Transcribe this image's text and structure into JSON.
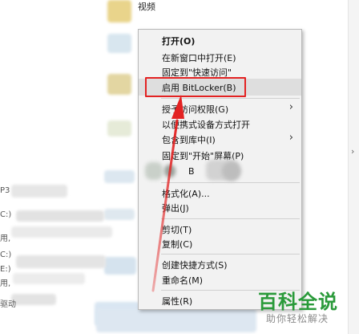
{
  "background": {
    "top_label": "视频",
    "left_partial": [
      "P3",
      "C:)",
      "用,",
      "C:)",
      "E:)",
      "用,",
      "驱动"
    ]
  },
  "context_menu": {
    "items": [
      {
        "label": "打开(O)",
        "bold": true
      },
      {
        "label": "在新窗口中打开(E)"
      },
      {
        "label": "固定到\"快速访问\""
      },
      {
        "label": "启用 BitLocker(B)",
        "highlighted": true
      },
      {
        "label": "授予访问权限(G)",
        "submenu": true
      },
      {
        "label": "以便携式设备方式打开"
      },
      {
        "label": "包含到库中(I)",
        "submenu": true
      },
      {
        "label": "固定到\"开始\"屏幕(P)"
      },
      {
        "label": "B"
      },
      {
        "label": "格式化(A)..."
      },
      {
        "label": "弹出(J)"
      },
      {
        "label": "剪切(T)"
      },
      {
        "label": "复制(C)"
      },
      {
        "label": "创建快捷方式(S)"
      },
      {
        "label": "重命名(M)"
      },
      {
        "label": "属性(R)"
      }
    ]
  },
  "watermark": {
    "logo": "百科全说",
    "subtitle": "助你轻松解决"
  },
  "colors": {
    "annotation_red": "#e32222",
    "menu_bg": "#f2f2f2",
    "watermark_green": "#2a9a3a"
  }
}
